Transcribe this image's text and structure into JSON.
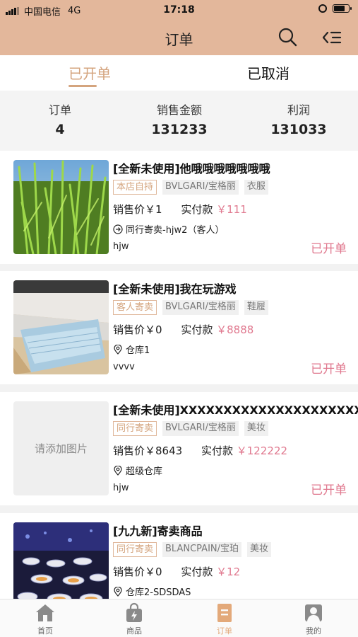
{
  "status_bar": {
    "carrier": "中国电信",
    "network": "4G",
    "time": "17:18"
  },
  "header": {
    "title": "订单"
  },
  "tabs": [
    {
      "label": "已开单",
      "active": true
    },
    {
      "label": "已取消",
      "active": false
    }
  ],
  "summary": [
    {
      "label": "订单",
      "value": "4"
    },
    {
      "label": "销售金额",
      "value": "131233"
    },
    {
      "label": "利润",
      "value": "131033"
    }
  ],
  "orders": [
    {
      "title": "[全新未使用]他哦哦哦哦哦哦哦",
      "source_tag": "本店自持",
      "brand_tag": "BVLGARI/宝格丽",
      "category_tag": "衣服",
      "sale_price": "销售价￥1",
      "paid_label": "实付款",
      "paid": "￥111",
      "location_icon": "arrow-circle-icon",
      "location": "同行寄卖-hjw2（客人）",
      "user": "hjw",
      "status": "已开单"
    },
    {
      "title": "[全新未使用]我在玩游戏",
      "source_tag": "客人寄卖",
      "brand_tag": "BVLGARI/宝格丽",
      "category_tag": "鞋履",
      "sale_price": "销售价￥0",
      "paid_label": "实付款",
      "paid": "￥8888",
      "location_icon": "location-pin-icon",
      "location": "仓库1",
      "user": "vvvv",
      "status": "已开单"
    },
    {
      "title": "[全新未使用]XXXXXXXXXXXXXXXXXXXXXXXX",
      "source_tag": "同行寄卖",
      "brand_tag": "BVLGARI/宝格丽",
      "category_tag": "美妆",
      "sale_price": "销售价￥8643",
      "paid_label": "实付款",
      "paid": "￥122222",
      "location_icon": "location-pin-icon",
      "location": "超级仓库",
      "user": "hjw",
      "status": "已开单",
      "image_placeholder": "请添加图片"
    },
    {
      "title": "[九九新]寄卖商品",
      "source_tag": "同行寄卖",
      "brand_tag": "BLANCPAIN/宝珀",
      "category_tag": "美妆",
      "sale_price": "销售价￥0",
      "paid_label": "实付款",
      "paid": "￥12",
      "location_icon": "location-pin-icon",
      "location": "仓库2-SDSDAS",
      "user": "",
      "status": ""
    }
  ],
  "tabbar": [
    {
      "label": "首页",
      "icon": "home-icon",
      "active": false
    },
    {
      "label": "商品",
      "icon": "shopping-bag-icon",
      "active": false
    },
    {
      "label": "订单",
      "icon": "order-list-icon",
      "active": true
    },
    {
      "label": "我的",
      "icon": "profile-icon",
      "active": false
    }
  ],
  "colors": {
    "header_bg": "#e3b79b",
    "accent": "#d4a47e",
    "price_pink": "#e0798f"
  }
}
